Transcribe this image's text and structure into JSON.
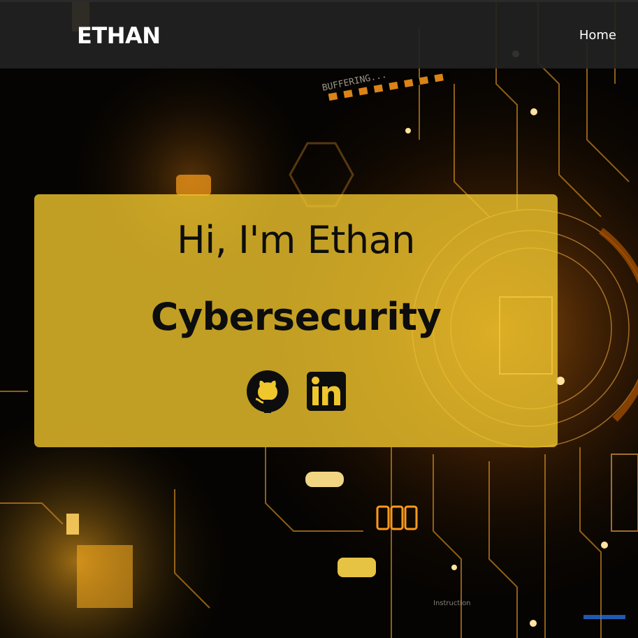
{
  "navbar": {
    "brand": "ETHAN",
    "links": [
      {
        "label": "Home"
      }
    ]
  },
  "hero": {
    "greeting": "Hi, I'm Ethan",
    "role": "Cybersecurity",
    "social": [
      {
        "name": "GitHub",
        "icon": "github-icon"
      },
      {
        "name": "LinkedIn",
        "icon": "linkedin-icon"
      }
    ]
  },
  "background": {
    "texts": [
      "BUFFERING...",
      "Instruction"
    ]
  },
  "colors": {
    "navbar_bg": "#222222",
    "card_bg": "#f0c62d",
    "accent_orange": "#ff9a1a",
    "text_dark": "#0d0d0d",
    "text_light": "#ffffff"
  }
}
